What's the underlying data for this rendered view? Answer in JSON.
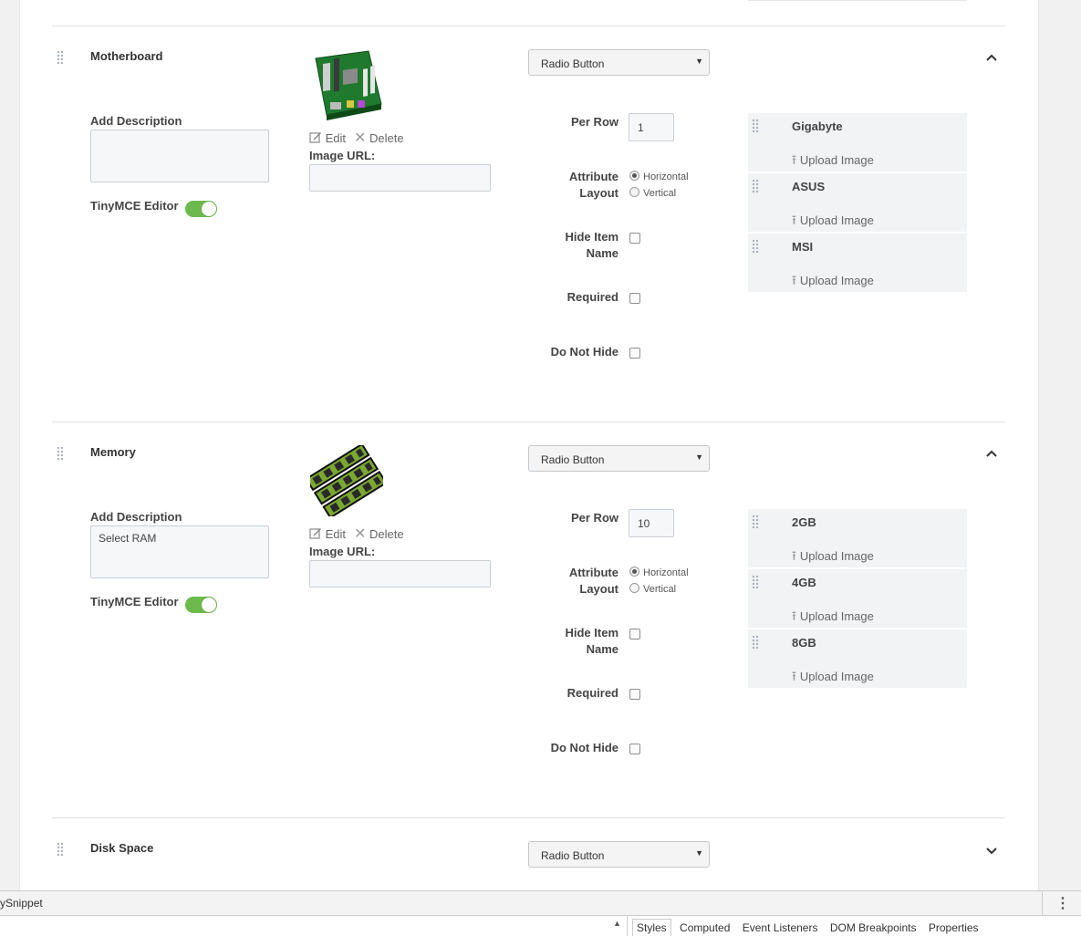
{
  "sections": [
    {
      "title": "Motherboard",
      "add_description_label": "Add Description",
      "description_value": "",
      "tinymce_label": "TinyMCE Editor",
      "tinymce_on": true,
      "edit_label": "Edit",
      "delete_label": "Delete",
      "image_url_label": "Image URL:",
      "type_select": "Radio Button",
      "per_row_label": "Per Row",
      "per_row_value": "1",
      "attribute_layout_label_1": "Attribute",
      "attribute_layout_label_2": "Layout",
      "horizontal_label": "Horizontal",
      "vertical_label": "Vertical",
      "layout_selected": "Horizontal",
      "hide_item_label_1": "Hide Item",
      "hide_item_label_2": "Name",
      "required_label": "Required",
      "do_not_hide_label": "Do Not Hide",
      "options": [
        {
          "name": "Gigabyte",
          "upload_label": "Upload Image"
        },
        {
          "name": "ASUS",
          "upload_label": "Upload Image"
        },
        {
          "name": "MSI",
          "upload_label": "Upload Image"
        }
      ],
      "expanded": true
    },
    {
      "title": "Memory",
      "add_description_label": "Add Description",
      "description_value": "Select RAM",
      "tinymce_label": "TinyMCE Editor",
      "tinymce_on": true,
      "edit_label": "Edit",
      "delete_label": "Delete",
      "image_url_label": "Image URL:",
      "type_select": "Radio Button",
      "per_row_label": "Per Row",
      "per_row_value": "10",
      "attribute_layout_label_1": "Attribute",
      "attribute_layout_label_2": "Layout",
      "horizontal_label": "Horizontal",
      "vertical_label": "Vertical",
      "layout_selected": "Horizontal",
      "hide_item_label_1": "Hide Item",
      "hide_item_label_2": "Name",
      "required_label": "Required",
      "do_not_hide_label": "Do Not Hide",
      "options": [
        {
          "name": "2GB",
          "upload_label": "Upload Image"
        },
        {
          "name": "4GB",
          "upload_label": "Upload Image"
        },
        {
          "name": "8GB",
          "upload_label": "Upload Image"
        }
      ],
      "expanded": true
    },
    {
      "title": "Disk Space",
      "type_select": "Radio Button",
      "expanded": false
    }
  ],
  "devtools": {
    "left_label": "ySnippet",
    "tabs": [
      "Styles",
      "Computed",
      "Event Listeners",
      "DOM Breakpoints",
      "Properties"
    ],
    "active_tab": "Styles"
  },
  "colors": {
    "toggle_on": "#6cba4c",
    "option_bg": "#f1f3f5",
    "input_bg": "#f6f7f9"
  },
  "icons": {
    "drag": "drag-handle-icon",
    "edit": "edit-icon",
    "delete": "delete-x-icon",
    "upload": "upload-arrow-icon",
    "collapse": "chevron-up-icon",
    "expand": "chevron-down-icon"
  }
}
